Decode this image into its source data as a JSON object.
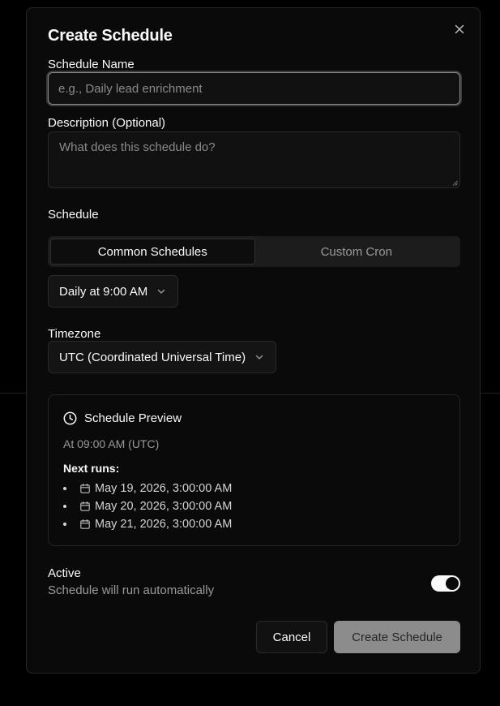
{
  "dialog": {
    "title": "Create Schedule",
    "close_label": "×"
  },
  "form": {
    "name_label": "Schedule Name",
    "name_placeholder": "e.g., Daily lead enrichment",
    "name_value": "",
    "description_label": "Description (Optional)",
    "description_placeholder": "What does this schedule do?",
    "description_value": "",
    "schedule_label": "Schedule",
    "tabs": [
      {
        "label": "Common Schedules",
        "active": true
      },
      {
        "label": "Custom Cron",
        "active": false
      }
    ],
    "frequency_selected": "Daily at 9:00 AM",
    "timezone_label": "Timezone",
    "timezone_selected": "UTC (Coordinated Universal Time)"
  },
  "preview": {
    "title": "Schedule Preview",
    "description": "At 09:00 AM (UTC)",
    "next_runs_label": "Next runs:",
    "next_runs": [
      "May 19, 2026, 3:00:00 AM",
      "May 20, 2026, 3:00:00 AM",
      "May 21, 2026, 3:00:00 AM"
    ]
  },
  "active": {
    "label": "Active",
    "description": "Schedule will run automatically",
    "enabled": true
  },
  "actions": {
    "cancel_label": "Cancel",
    "create_label": "Create Schedule"
  },
  "colors": {
    "background": "#000000",
    "modal": "#0a0a0a",
    "border": "#262626",
    "text": "#fafafa",
    "muted": "#9a9a9a",
    "primary_disabled": "#8c8c8c"
  },
  "icons": {
    "close": "close-icon",
    "chevron": "chevron-down-icon",
    "clock": "clock-icon",
    "calendar": "calendar-icon"
  }
}
